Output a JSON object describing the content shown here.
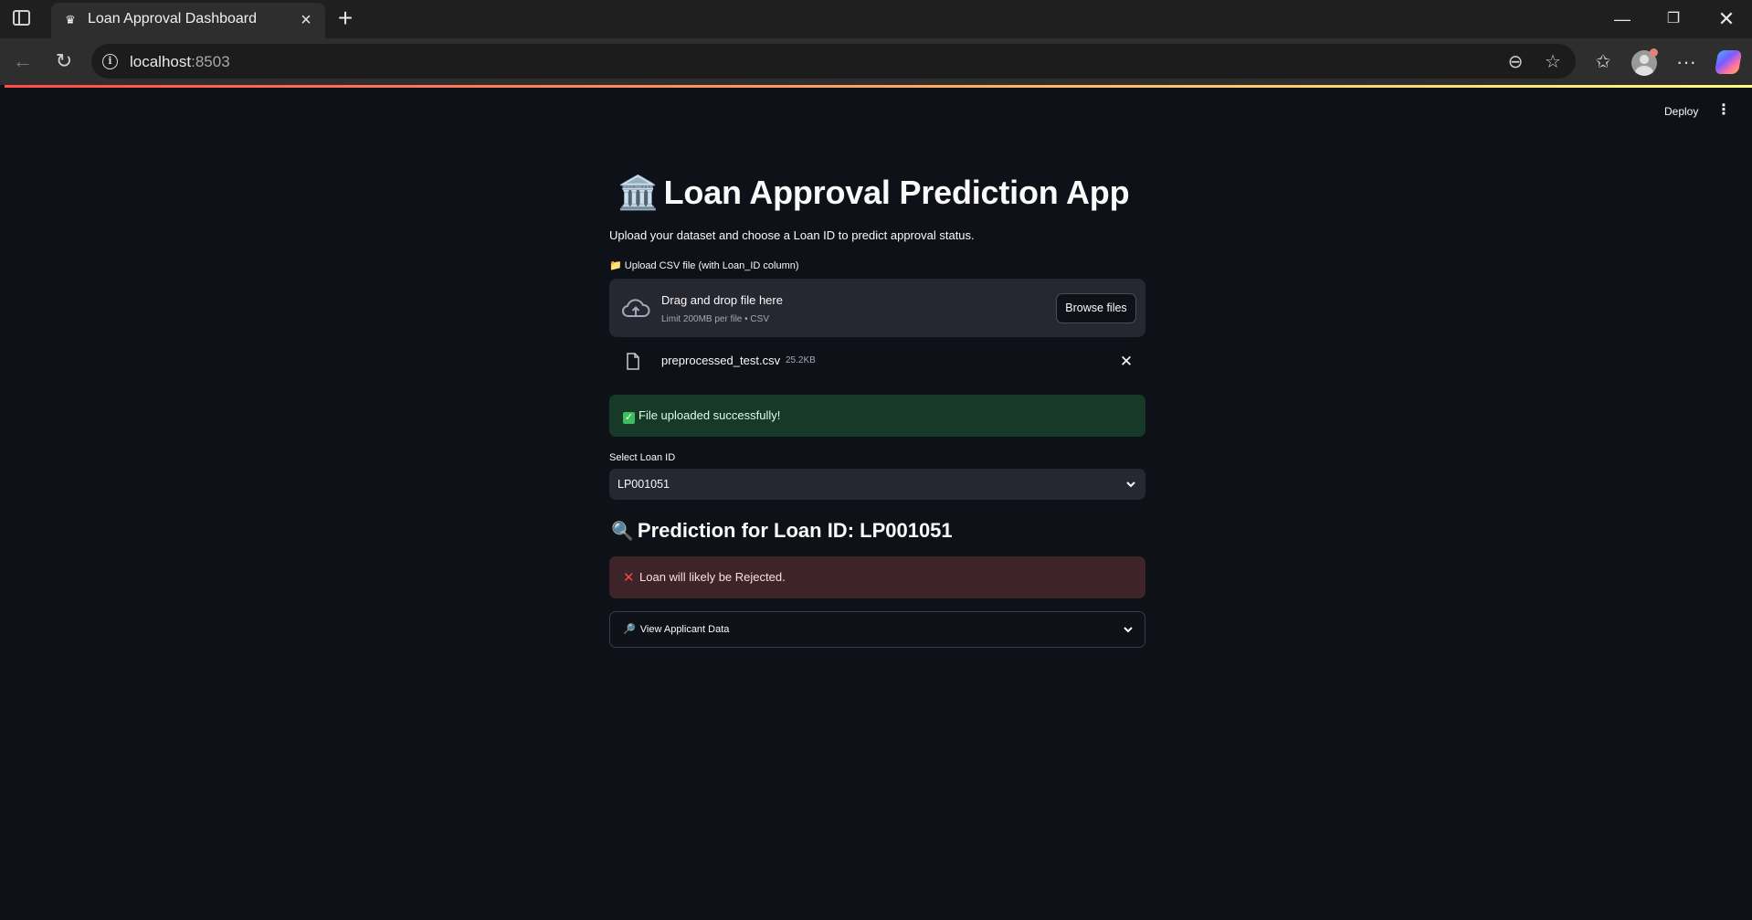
{
  "browser": {
    "tab_title": "Loan Approval Dashboard",
    "url_host": "localhost",
    "url_port": ":8503"
  },
  "app_header": {
    "deploy_label": "Deploy",
    "menu_glyph": "⋮"
  },
  "main": {
    "title_emoji": "🏛️",
    "title_text": "Loan Approval Prediction App",
    "subtitle": "Upload your dataset and choose a Loan ID to predict approval status.",
    "uploader": {
      "label": "📁 Upload CSV file (with Loan_ID column)",
      "drag_text": "Drag and drop file here",
      "limit_text": "Limit 200MB per file • CSV",
      "browse_label": "Browse files",
      "file_name": "preprocessed_test.csv",
      "file_size": "25.2KB"
    },
    "success_message": "File uploaded successfully!",
    "select": {
      "label": "Select Loan ID",
      "value": "LP001051"
    },
    "prediction": {
      "emoji": "🔍",
      "heading": "Prediction for Loan ID: LP001051",
      "result_message": "Loan will likely be Rejected."
    },
    "expander": {
      "emoji": "🔎",
      "label": "View Applicant Data"
    }
  },
  "colors": {
    "background": "#0e1117",
    "widget_bg": "#262730",
    "success_bg": "#173928",
    "error_bg": "#3e2428"
  }
}
